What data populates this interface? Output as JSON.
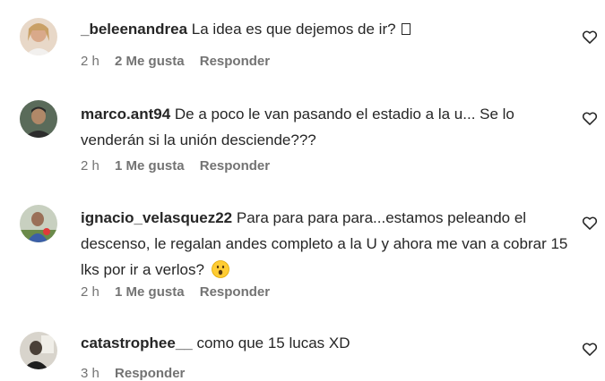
{
  "comments": [
    {
      "username": "_beleenandrea",
      "text": "La idea es que dejemos de ir?",
      "time": "2 h",
      "likes": "2 Me gusta",
      "reply": "Responder"
    },
    {
      "username": "marco.ant94",
      "text": "De a poco le van pasando el estadio a la u... Se lo venderán si la unión desciende???",
      "time": "2 h",
      "likes": "1 Me gusta",
      "reply": "Responder"
    },
    {
      "username": "ignacio_velasquez22",
      "text": "Para para para para...estamos peleando el descenso, le regalan andes completo a la U y ahora me van a cobrar 15 lks por ir a verlos?",
      "time": "2 h",
      "likes": "1 Me gusta",
      "reply": "Responder"
    },
    {
      "username": "catastrophee__",
      "text": "como que 15 lucas XD",
      "time": "3 h",
      "reply": "Responder"
    }
  ],
  "icons": {
    "like": "heart-outline-icon",
    "emoji_missing": "missing-glyph-box",
    "emoji_surprised": "surprised-face-emoji"
  },
  "colors": {
    "text": "#262626",
    "meta": "#737373",
    "background": "#ffffff"
  }
}
